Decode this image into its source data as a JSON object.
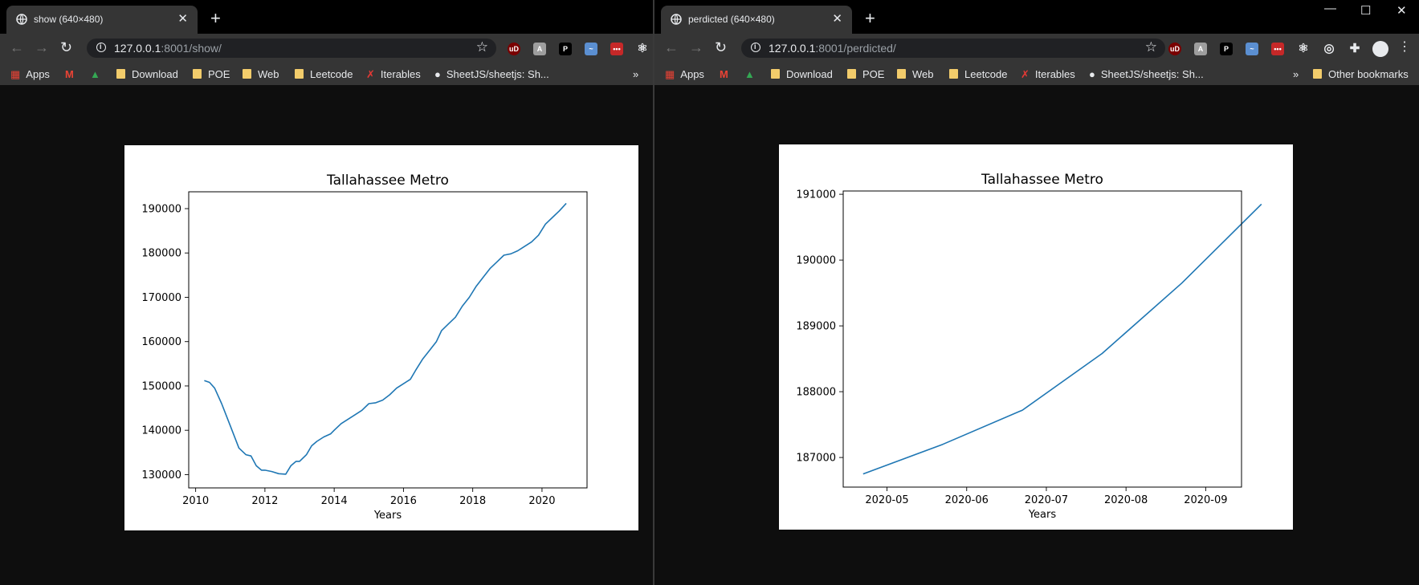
{
  "left": {
    "tab_title": "show (640×480)",
    "url_host": "127.0.0.1",
    "url_path": ":8001/show/",
    "bookmarks": {
      "apps": "Apps",
      "download": "Download",
      "poe": "POE",
      "web": "Web",
      "leetcode": "Leetcode",
      "iterables": "Iterables",
      "sheetjs": "SheetJS/sheetjs: Sh...",
      "more": "»"
    },
    "extensions": [
      "ublock-icon",
      "extension-gray-icon",
      "p-extension-icon",
      "extension-blue-icon",
      "extension-red-icon",
      "react-devtools-icon"
    ]
  },
  "right": {
    "tab_title": "perdicted (640×480)",
    "url_host": "127.0.0.1",
    "url_path": ":8001/perdicted/",
    "bookmarks": {
      "apps": "Apps",
      "download": "Download",
      "poe": "POE",
      "web": "Web",
      "leetcode": "Leetcode",
      "iterables": "Iterables",
      "sheetjs": "SheetJS/sheetjs: Sh...",
      "more": "»",
      "other": "Other bookmarks"
    },
    "extensions": [
      "ublock-icon",
      "extension-gray-icon",
      "p-extension-icon",
      "extension-blue-icon",
      "extension-red-icon",
      "react-devtools-icon",
      "target-icon",
      "puzzle-icon",
      "profile-avatar"
    ]
  },
  "colors": {
    "tabstrip": "#000000",
    "toolbar": "#353535",
    "content": "#0e0e0e",
    "line": "#1f77b4"
  },
  "chart_data": [
    {
      "type": "line",
      "title": "Tallahassee Metro",
      "xlabel": "Years",
      "ylabel": "",
      "xlim": [
        2009.8,
        2021.3
      ],
      "ylim": [
        127000,
        193800
      ],
      "xticks": [
        2010,
        2012,
        2014,
        2016,
        2018,
        2020
      ],
      "xtick_labels": [
        "2010",
        "2012",
        "2014",
        "2016",
        "2018",
        "2020"
      ],
      "yticks": [
        130000,
        140000,
        150000,
        160000,
        170000,
        180000,
        190000
      ],
      "ytick_labels": [
        "130000",
        "140000",
        "150000",
        "160000",
        "170000",
        "180000",
        "190000"
      ],
      "grid": false,
      "series": [
        {
          "x": [
            2010.25,
            2010.4,
            2010.55,
            2010.75,
            2011.0,
            2011.25,
            2011.45,
            2011.6,
            2011.75,
            2011.9,
            2012.0,
            2012.2,
            2012.4,
            2012.6,
            2012.75,
            2012.9,
            2013.0,
            2013.2,
            2013.35,
            2013.5,
            2013.7,
            2013.9,
            2014.0,
            2014.2,
            2014.4,
            2014.6,
            2014.8,
            2015.0,
            2015.2,
            2015.4,
            2015.6,
            2015.8,
            2016.0,
            2016.2,
            2016.35,
            2016.55,
            2016.75,
            2016.95,
            2017.1,
            2017.3,
            2017.5,
            2017.7,
            2017.9,
            2018.1,
            2018.3,
            2018.5,
            2018.7,
            2018.9,
            2019.1,
            2019.3,
            2019.5,
            2019.7,
            2019.9,
            2020.1,
            2020.3,
            2020.5,
            2020.7
          ],
          "y": [
            151200,
            150800,
            149500,
            146000,
            141000,
            136000,
            134500,
            134200,
            132000,
            131000,
            131000,
            130700,
            130200,
            130100,
            132000,
            133000,
            133000,
            134500,
            136500,
            137500,
            138500,
            139200,
            140000,
            141500,
            142500,
            143500,
            144500,
            146000,
            146200,
            146800,
            148000,
            149500,
            150500,
            151500,
            153500,
            156000,
            158000,
            160000,
            162500,
            164000,
            165500,
            168000,
            170000,
            172500,
            174500,
            176500,
            178000,
            179500,
            179800,
            180500,
            181500,
            182500,
            184000,
            186500,
            188000,
            189500,
            191200
          ]
        }
      ]
    },
    {
      "type": "line",
      "title": "Tallahassee Metro",
      "xlabel": "Years",
      "ylabel": "",
      "xlim": [
        0,
        5
      ],
      "ylim": [
        186550,
        191050
      ],
      "xticks": [
        0.55,
        1.55,
        2.55,
        3.55,
        4.55
      ],
      "xtick_labels": [
        "2020-05",
        "2020-06",
        "2020-07",
        "2020-08",
        "2020-09"
      ],
      "yticks": [
        187000,
        188000,
        189000,
        190000,
        191000
      ],
      "ytick_labels": [
        "187000",
        "188000",
        "189000",
        "190000",
        "191000"
      ],
      "grid": false,
      "series": [
        {
          "x": [
            0.25,
            1.25,
            2.25,
            3.25,
            4.25,
            5.25
          ],
          "y": [
            186750,
            187200,
            187720,
            188580,
            189650,
            190850
          ]
        }
      ]
    }
  ]
}
